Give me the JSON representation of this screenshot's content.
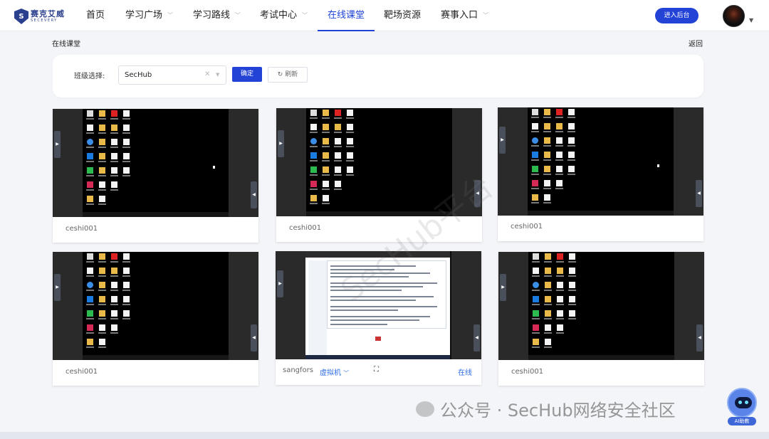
{
  "header": {
    "logo_cn": "赛克艾威",
    "logo_en": "SECEVERY",
    "nav": [
      {
        "label": "首页"
      },
      {
        "label": "学习广场"
      },
      {
        "label": "学习路线"
      },
      {
        "label": "考试中心"
      },
      {
        "label": "在线课堂"
      },
      {
        "label": "靶场资源"
      },
      {
        "label": "赛事入口"
      }
    ],
    "admin_button": "进入后台"
  },
  "breadcrumb": "在线课堂",
  "back": "返回",
  "filter": {
    "label": "班级选择:",
    "selected": "SecHub",
    "confirm": "确定",
    "refresh": "刷新"
  },
  "cards": [
    {
      "caption": "ceshi001"
    },
    {
      "caption": "ceshi001"
    },
    {
      "caption": "ceshi001"
    },
    {
      "caption": "ceshi001"
    },
    {
      "caption": "sangfors",
      "option": "虚拟机",
      "status": "在线"
    },
    {
      "caption": "ceshi001"
    }
  ],
  "watermark": "SecHub平台",
  "wechat_watermark": "公众号 · SecHub网络安全社区",
  "ai_help": "AI助教",
  "colors": {
    "accent": "#2342d6",
    "link": "#2f6ee8",
    "background": "#f3f5f9"
  }
}
